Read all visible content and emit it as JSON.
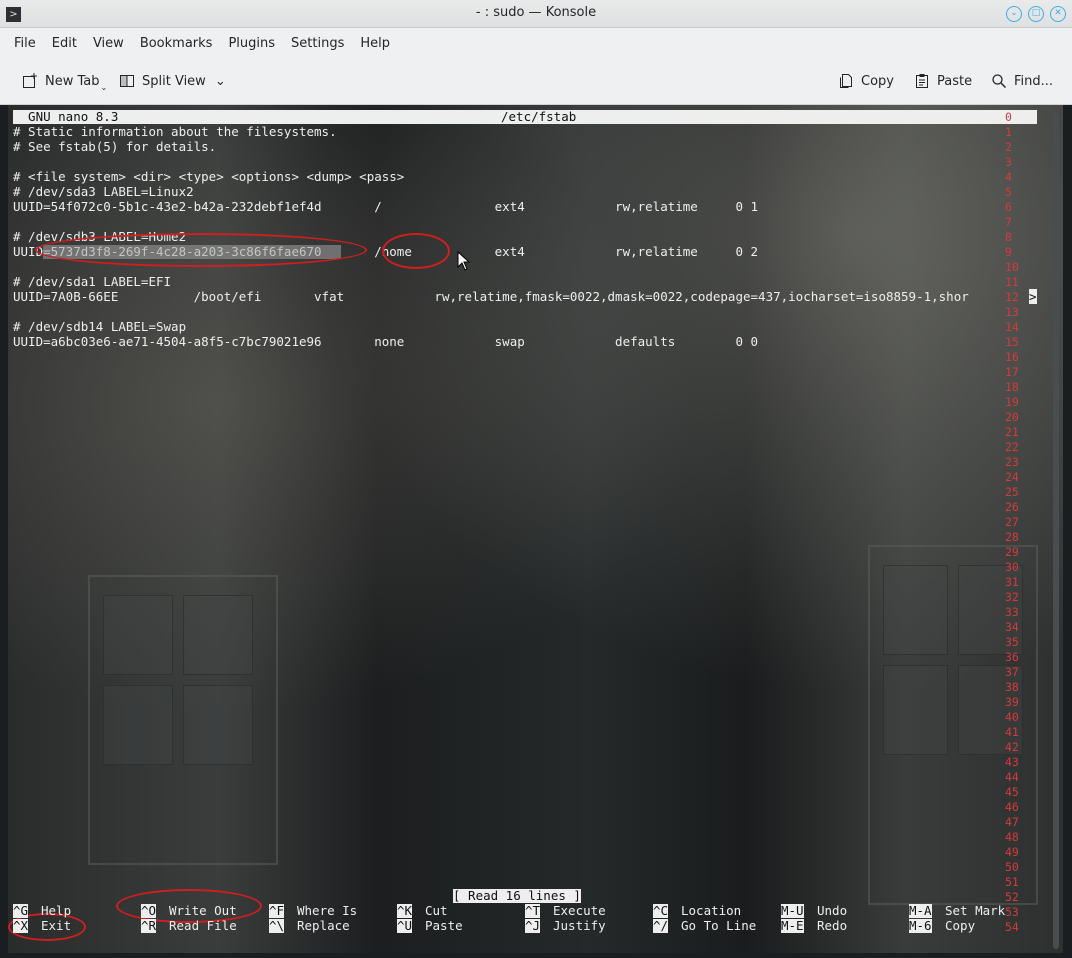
{
  "window": {
    "title": "- : sudo — Konsole",
    "app_icon": ">"
  },
  "menubar": [
    "File",
    "Edit",
    "View",
    "Bookmarks",
    "Plugins",
    "Settings",
    "Help"
  ],
  "toolbar": {
    "new_tab": "New Tab",
    "split_view": "Split View",
    "copy": "Copy",
    "paste": "Paste",
    "find": "Find..."
  },
  "nano": {
    "header_left": "  GNU nano 8.3",
    "header_center": "/etc/fstab",
    "lines": [
      "# Static information about the filesystems.",
      "# See fstab(5) for details.",
      "",
      "# <file system> <dir> <type> <options> <dump> <pass>",
      "# /dev/sda3 LABEL=Linux2",
      "UUID=54f072c0-5b1c-43e2-b42a-232debf1ef4d       /               ext4            rw,relatime     0 1",
      "",
      "# /dev/sdb3 LABEL=Home2",
      "UUID=5737d3f8-269f-4c28-a203-3c86f6fae670       /home           ext4            rw,relatime     0 2",
      "",
      "# /dev/sda1 LABEL=EFI",
      "UUID=7A0B-66EE          /boot/efi       vfat            rw,relatime,fmask=0022,dmask=0022,codepage=437,iocharset=iso8859-1,shor",
      "",
      "# /dev/sdb14 LABEL=Swap",
      "UUID=a6bc03e6-ae71-4504-a8f5-c7bc79021e96       none            swap            defaults        0 0"
    ],
    "overflow_marker": ">",
    "line_numbers": [
      "0",
      "1",
      "2",
      "3",
      "4",
      "5",
      "6",
      "7",
      "8",
      "9",
      "10",
      "11",
      "12",
      "13",
      "14",
      "15",
      "16",
      "17",
      "18",
      "19",
      "20",
      "21",
      "22",
      "23",
      "24",
      "25",
      "26",
      "27",
      "28",
      "29",
      "30",
      "31",
      "32",
      "33",
      "34",
      "35",
      "36",
      "37",
      "38",
      "39",
      "40",
      "41",
      "42",
      "43",
      "44",
      "45",
      "46",
      "47",
      "48",
      "49",
      "50",
      "51",
      "52",
      "53",
      "54"
    ],
    "status": "[ Read 16 lines ]",
    "shortcuts_row1": [
      {
        "key": "^G",
        "label": "Help"
      },
      {
        "key": "^O",
        "label": "Write Out"
      },
      {
        "key": "^F",
        "label": "Where Is"
      },
      {
        "key": "^K",
        "label": "Cut"
      },
      {
        "key": "^T",
        "label": "Execute"
      },
      {
        "key": "^C",
        "label": "Location"
      },
      {
        "key": "M-U",
        "label": "Undo"
      },
      {
        "key": "M-A",
        "label": "Set Mark"
      }
    ],
    "shortcuts_row2": [
      {
        "key": "^X",
        "label": "Exit"
      },
      {
        "key": "^R",
        "label": "Read File"
      },
      {
        "key": "^\\",
        "label": "Replace"
      },
      {
        "key": "^U",
        "label": "Paste"
      },
      {
        "key": "^J",
        "label": "Justify"
      },
      {
        "key": "^/",
        "label": "Go To Line"
      },
      {
        "key": "M-E",
        "label": "Redo"
      },
      {
        "key": "M-6",
        "label": "Copy"
      }
    ]
  },
  "colors": {
    "accent": "#3daee9",
    "annotation_red": "#d11e1e",
    "line_number_red": "#d43b3b"
  }
}
